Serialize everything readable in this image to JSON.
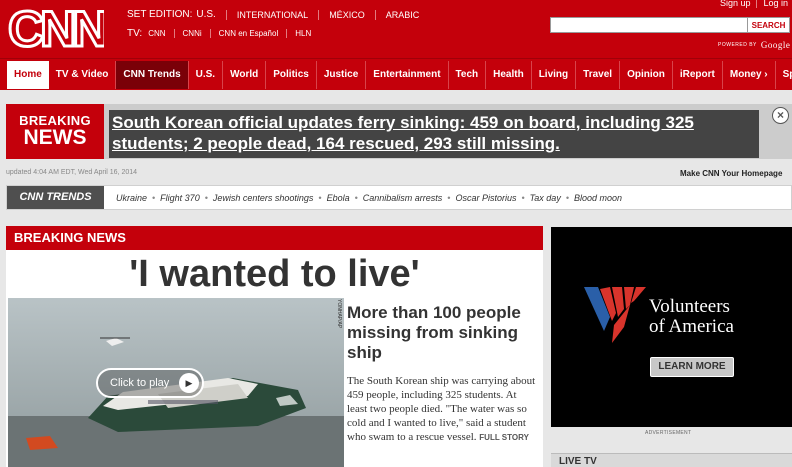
{
  "header": {
    "logo_text": "CNN",
    "edition_label": "SET EDITION:",
    "edition_selected": "U.S.",
    "edition_options": [
      "INTERNATIONAL",
      "MÉXICO",
      "ARABIC"
    ],
    "tv_label": "TV:",
    "tv_options": [
      "CNN",
      "CNNi",
      "CNN en Español",
      "HLN"
    ],
    "sign_up": "Sign up",
    "log_in": "Log in",
    "search_placeholder": "",
    "search_button": "SEARCH",
    "powered_by": "POWERED BY",
    "powered_brand": "Google"
  },
  "nav": {
    "items": [
      "Home",
      "TV & Video",
      "CNN Trends",
      "U.S.",
      "World",
      "Politics",
      "Justice",
      "Entertainment",
      "Tech",
      "Health",
      "Living",
      "Travel",
      "Opinion",
      "iReport",
      "Money ›",
      "Sports ›"
    ]
  },
  "breaking_banner": {
    "tag_line1": "BREAKING",
    "tag_line2": "NEWS",
    "text": "South Korean official updates ferry sinking: 459 on board, including 325 students; 2 people dead, 164 rescued, 293 still missing.",
    "close": "×"
  },
  "meta": {
    "updated": "updated 4:04 AM EDT, Wed April 16, 2014",
    "make_home": "Make CNN Your Homepage"
  },
  "trends": {
    "logo": "CNN TRENDS",
    "items": [
      "Ukraine",
      "Flight 370",
      "Jewish centers shootings",
      "Ebola",
      "Cannibalism arrests",
      "Oscar Pistorius",
      "Tax day",
      "Blood moon"
    ]
  },
  "main_story": {
    "section_label": "BREAKING NEWS",
    "headline": "'I wanted to live'",
    "play_label": "Click to play",
    "photo_credit": "YONHAP/AP",
    "subhead": "More than 100 people missing from sinking ship",
    "summary": "The South Korean ship was carrying about 459 people, including 325 students. At least two people died. \"The water was so cold and I wanted to live,\" said a student who swam to a rescue vessel.",
    "full_story": "FULL STORY"
  },
  "ad": {
    "org_line1": "Volunteers",
    "org_line2": "of America",
    "learn_more": "LEARN MORE",
    "label": "ADVERTISEMENT",
    "colors": {
      "blue": "#2a5fa8",
      "red": "#d8342c"
    }
  },
  "live_tv": {
    "label": "LIVE TV"
  }
}
